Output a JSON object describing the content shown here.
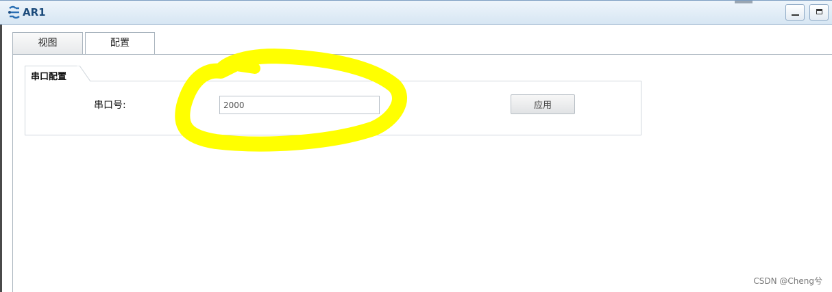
{
  "window": {
    "title": "AR1"
  },
  "tabs": [
    {
      "label": "视图"
    },
    {
      "label": "配置"
    }
  ],
  "serial_config": {
    "section_title": "串口配置",
    "port_label": "串口号:",
    "port_value": "2000",
    "apply_label": "应用"
  },
  "annotation": {
    "color": "#ffff00"
  },
  "watermark": "CSDN @Cheng兮"
}
